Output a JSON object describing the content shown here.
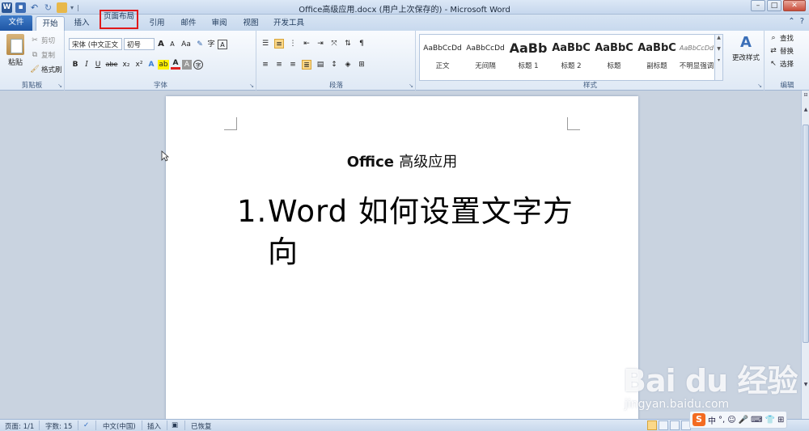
{
  "window": {
    "title": "Office高级应用.docx (用户上次保存的) - Microsoft Word",
    "controls": [
      "–",
      "□",
      "✕"
    ]
  },
  "qat": {
    "separator": "|"
  },
  "tabs": [
    {
      "label": "文件"
    },
    {
      "label": "开始"
    },
    {
      "label": "插入"
    },
    {
      "label": "页面布局"
    },
    {
      "label": "引用"
    },
    {
      "label": "邮件"
    },
    {
      "label": "审阅"
    },
    {
      "label": "视图"
    },
    {
      "label": "开发工具"
    }
  ],
  "ribbon": {
    "clipboard": {
      "label": "剪贴板",
      "paste": "粘贴",
      "cut": "剪切",
      "copy": "复制",
      "format_painter": "格式刷"
    },
    "font": {
      "label": "字体",
      "font_name": "宋体 (中文正文",
      "font_size": "初号",
      "grow": "A",
      "shrink": "A",
      "change_case": "Aa",
      "bold": "B",
      "italic": "I",
      "underline": "U",
      "strike": "abe",
      "subscript": "x₂",
      "superscript": "x²",
      "text_effect": "A",
      "highlight": "ab",
      "font_color": "A",
      "char_shading": "A",
      "enclose": "字"
    },
    "paragraph": {
      "label": "段落"
    },
    "styles": {
      "label": "样式",
      "items": [
        {
          "sample": "AaBbCcDd",
          "name": "正文"
        },
        {
          "sample": "AaBbCcDd",
          "name": "无间隔"
        },
        {
          "sample": "AaBb",
          "name": "标题 1"
        },
        {
          "sample": "AaBbC",
          "name": "标题 2"
        },
        {
          "sample": "AaBbC",
          "name": "标题"
        },
        {
          "sample": "AaBbC",
          "name": "副标题"
        },
        {
          "sample": "AaBbCcDd",
          "name": "不明显强调"
        }
      ],
      "change_styles": "更改样式"
    },
    "editing": {
      "label": "编辑",
      "find": "查找",
      "replace": "替换",
      "select": "选择"
    }
  },
  "document": {
    "title_latin": "Office",
    "title_cn": "高级应用",
    "list_number": "1.",
    "heading_text": "Word  如何设置文字方向"
  },
  "statusbar": {
    "page": "页面: 1/1",
    "words": "字数: 15",
    "language": "中文(中国)",
    "insert_mode": "插入",
    "recovered": "已恢复"
  },
  "ime": {
    "logo": "S",
    "mode": "中"
  },
  "watermark": {
    "brand": "Bai du 经验",
    "url": "jingyan.baidu.com"
  },
  "colors": {
    "file_tab": "#2b63b3",
    "highlight_box": "#e0191b",
    "ribbon_bg": "#eef3fa",
    "page_bg": "#ffffff",
    "workspace_bg": "#c9d3e0"
  }
}
